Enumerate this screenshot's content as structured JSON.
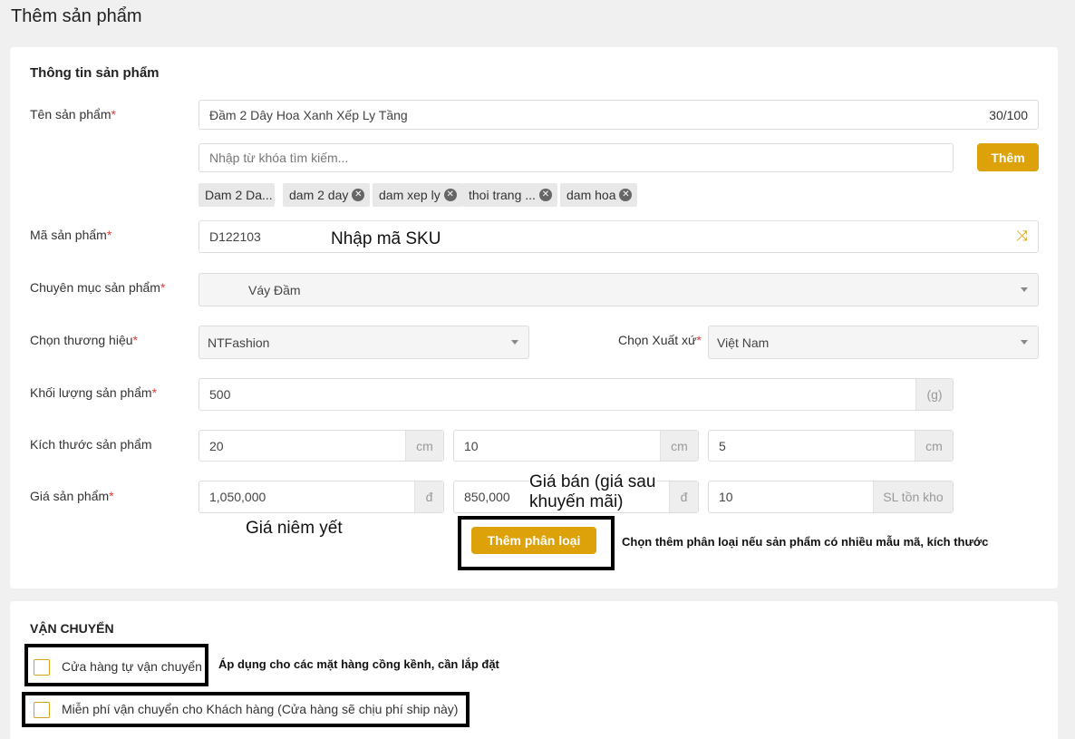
{
  "page_title": "Thêm sản phẩm",
  "product_info": {
    "section_title": "Thông tin sản phẩm",
    "name_label": "Tên sản phẩm",
    "name_value": "Đầm 2 Dây Hoa Xanh Xếp Ly Tầng",
    "name_counter": "30/100",
    "keyword_placeholder": "Nhập từ khóa tìm kiếm...",
    "add_keyword_label": "Thêm",
    "tags": [
      "Dam 2 Da...",
      "dam 2 day",
      "dam xep ly",
      "thoi trang ...",
      "dam hoa"
    ],
    "sku_label": "Mã sản phẩm",
    "sku_value": "D122103",
    "sku_annotation": "Nhập mã SKU",
    "category_label": "Chuyên mục sản phẩm",
    "category_value": "Váy Đầm",
    "brand_label": "Chọn thương hiệu",
    "brand_value": "NTFashion",
    "origin_label": "Chọn Xuất xứ",
    "origin_value": "Việt Nam",
    "weight_label": "Khối lượng sản phẩm",
    "weight_value": "500",
    "weight_unit": "(g)",
    "size_label": "Kích thước sản phẩm",
    "size_values": [
      "20",
      "10",
      "5"
    ],
    "size_unit": "cm",
    "price_label": "Giá sản phẩm",
    "list_price": "1,050,000",
    "sale_price": "850,000",
    "currency": "đ",
    "stock_value": "10",
    "stock_unit": "SL tồn kho",
    "list_price_annotation": "Giá niêm yết",
    "sale_price_annotation_1": "Giá bán (giá sau",
    "sale_price_annotation_2": "khuyến mãi)",
    "add_variant_label": "Thêm phân loại",
    "variant_note": "Chọn thêm phân loại nếu sản phẩm có nhiều mẫu mã, kích thước",
    "required_mark": "*"
  },
  "shipping": {
    "section_title": "VẬN CHUYỂN",
    "self_ship_label": "Cửa hàng tự vận chuyển",
    "self_ship_note": "Áp dụng cho các mặt hàng cồng kềnh, cần lắp đặt",
    "free_ship_label": "Miễn phí vận chuyển cho Khách hàng (Cửa hàng sẽ chịu phí ship này)"
  },
  "colors": {
    "accent": "#dda20a",
    "required": "#e53935",
    "background": "#f0f0f0"
  }
}
